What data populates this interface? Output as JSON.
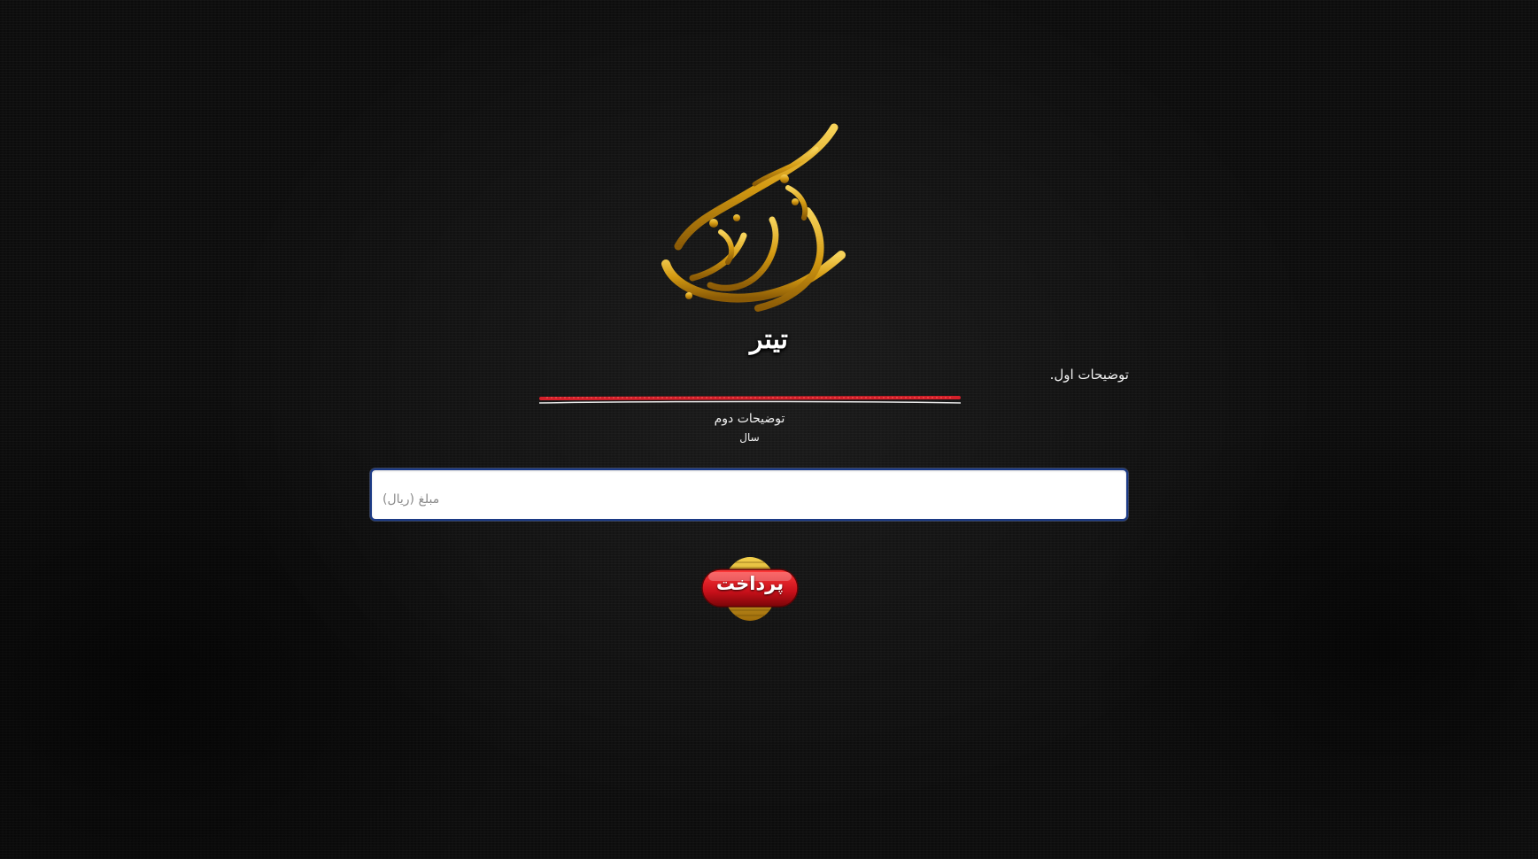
{
  "page": {
    "title": "تیتر",
    "description_first": "توضیحات اول.",
    "description_second": "توضیحات دوم",
    "year_label": "سال"
  },
  "logo": {
    "icon": "calligraphy-logo-icon",
    "text": "نذر فرهنگی",
    "color": "#d4a017"
  },
  "form": {
    "amount_placeholder": "مبلغ (ریال)",
    "amount_value": "",
    "pay_button_label": "پرداخت"
  },
  "colors": {
    "background": "#0f0f0f",
    "divider": "#d4202a",
    "button": "#d8181e",
    "input_border": "#1b3a86"
  }
}
